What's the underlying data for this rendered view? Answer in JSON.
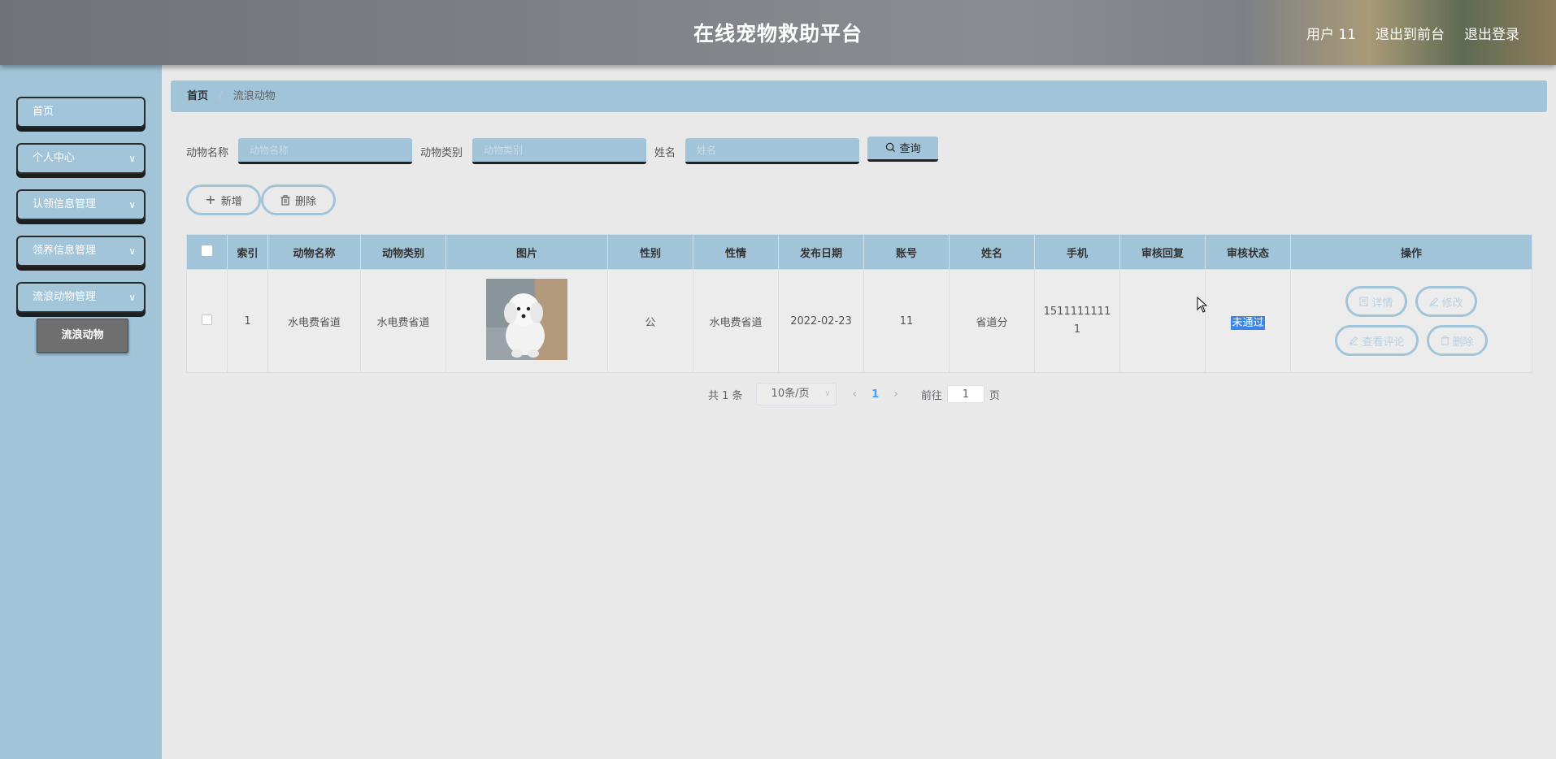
{
  "header": {
    "title": "在线宠物救助平台",
    "user_label": "用户 11",
    "to_front_label": "退出到前台",
    "logout_label": "退出登录"
  },
  "sidebar": {
    "items": [
      {
        "label": "首页",
        "has_children": false
      },
      {
        "label": "个人中心",
        "has_children": true
      },
      {
        "label": "认领信息管理",
        "has_children": true
      },
      {
        "label": "领养信息管理",
        "has_children": true
      },
      {
        "label": "流浪动物管理",
        "has_children": true
      }
    ],
    "active_sub": "流浪动物"
  },
  "breadcrumb": {
    "home": "首页",
    "separator": "/",
    "current": "流浪动物"
  },
  "search": {
    "animal_name_label": "动物名称",
    "animal_name_placeholder": "动物名称",
    "animal_type_label": "动物类别",
    "animal_type_placeholder": "动物类别",
    "name_label": "姓名",
    "name_placeholder": "姓名",
    "query_label": "查询"
  },
  "actions": {
    "add_label": "新增",
    "delete_label": "删除"
  },
  "table": {
    "columns": [
      "索引",
      "动物名称",
      "动物类别",
      "图片",
      "性别",
      "性情",
      "发布日期",
      "账号",
      "姓名",
      "手机",
      "审核回复",
      "审核状态",
      "操作"
    ],
    "rows": [
      {
        "index": "1",
        "animal_name": "水电费省道",
        "animal_type": "水电费省道",
        "gender": "公",
        "temperament": "水电费省道",
        "publish_date": "2022-02-23",
        "account": "11",
        "name": "省道分",
        "phone": "15111111111",
        "review_reply": "",
        "review_status": "未通过",
        "ops": {
          "detail": "详情",
          "edit": "修改",
          "comments": "查看评论",
          "delete": "删除"
        }
      }
    ]
  },
  "pagination": {
    "total_text": "共 1 条",
    "page_size": "10条/页",
    "current_page": "1",
    "goto_label": "前往",
    "goto_value": "1",
    "page_suffix": "页"
  },
  "colors": {
    "accent": "#a1c4d9",
    "header_gray": "#7f8388",
    "selection_blue": "#3a87e8"
  }
}
